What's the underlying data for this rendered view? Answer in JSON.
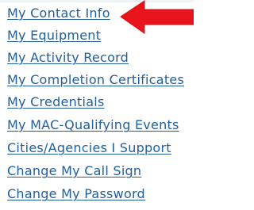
{
  "nav": {
    "items": [
      {
        "label": "My Contact Info"
      },
      {
        "label": "My Equipment"
      },
      {
        "label": "My Activity Record"
      },
      {
        "label": "My Completion Certificates"
      },
      {
        "label": "My Credentials"
      },
      {
        "label": "My MAC-Qualifying Events"
      },
      {
        "label": "Cities/Agencies I Support"
      },
      {
        "label": "Change My Call Sign"
      },
      {
        "label": "Change My Password"
      }
    ]
  },
  "colors": {
    "link": "#1f5fa0",
    "arrow": "#e8141c",
    "background": "#ffffff"
  },
  "annotation": {
    "icon": "arrow-left-icon",
    "points_to": "My Contact Info"
  }
}
